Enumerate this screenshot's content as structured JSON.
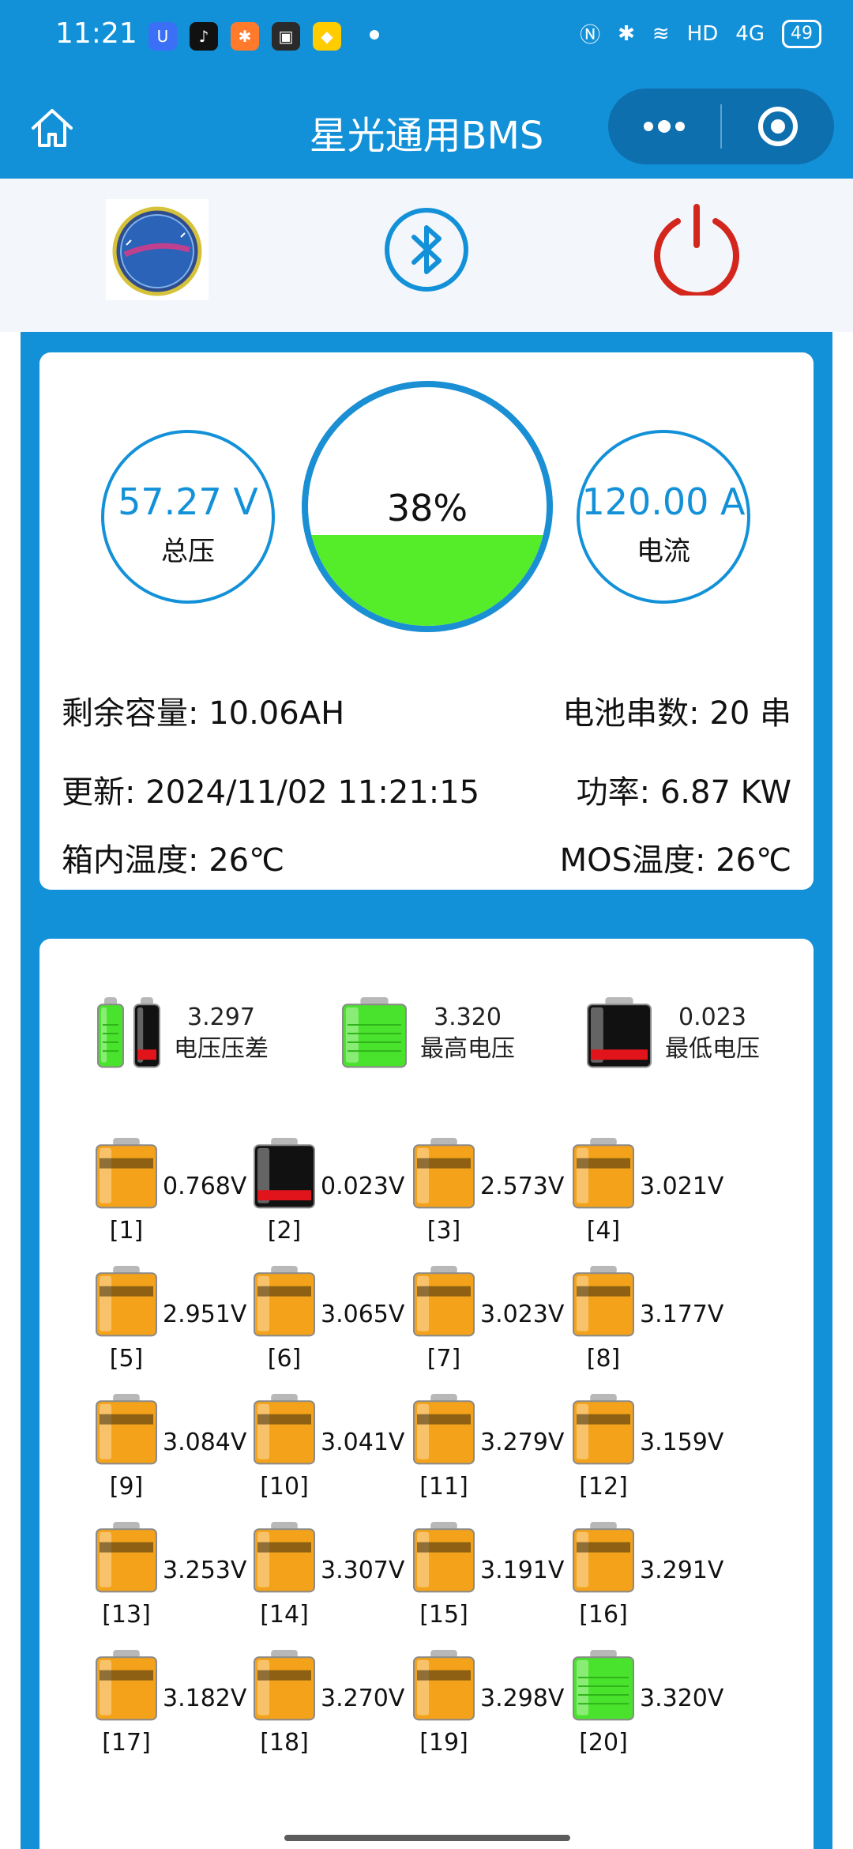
{
  "status_bar": {
    "time": "11:21",
    "apps": [
      {
        "name": "app-u",
        "glyph": "U",
        "color": "#3b6ff5"
      },
      {
        "name": "tiktok",
        "glyph": "♪",
        "color": "#111111"
      },
      {
        "name": "app-person",
        "glyph": "✱",
        "color": "#ff7a2a"
      },
      {
        "name": "app-dark",
        "glyph": "▣",
        "color": "#2a2a2a"
      },
      {
        "name": "app-yellow",
        "glyph": "◆",
        "color": "#ffcc00"
      }
    ],
    "network_label": "HD",
    "signal_label": "4G",
    "battery": "49"
  },
  "nav": {
    "title": "星光通用BMS"
  },
  "summary": {
    "total_voltage": "57.27 V",
    "total_voltage_label": "总压",
    "soc_text": "38%",
    "soc_fraction": 0.38,
    "current": "120.00 A",
    "current_label": "电流",
    "remaining_capacity": "剩余容量: 10.06AH",
    "series_count": "电池串数: 20 串",
    "updated": "更新:  2024/11/02 11:21:15",
    "power": "功率: 6.87 KW",
    "box_temp": "箱内温度:  26℃",
    "mos_temp": "MOS温度: 26℃"
  },
  "stats": [
    {
      "value": "3.297",
      "label": "电压压差",
      "kind": "diff"
    },
    {
      "value": "3.320",
      "label": "最高电压",
      "kind": "high"
    },
    {
      "value": "0.023",
      "label": "最低电压",
      "kind": "low"
    }
  ],
  "cells": [
    {
      "index": "[1]",
      "voltage": "0.768V",
      "kind": "normal"
    },
    {
      "index": "[2]",
      "voltage": "0.023V",
      "kind": "low"
    },
    {
      "index": "[3]",
      "voltage": "2.573V",
      "kind": "normal"
    },
    {
      "index": "[4]",
      "voltage": "3.021V",
      "kind": "normal"
    },
    {
      "index": "[5]",
      "voltage": "2.951V",
      "kind": "normal"
    },
    {
      "index": "[6]",
      "voltage": "3.065V",
      "kind": "normal"
    },
    {
      "index": "[7]",
      "voltage": "3.023V",
      "kind": "normal"
    },
    {
      "index": "[8]",
      "voltage": "3.177V",
      "kind": "normal"
    },
    {
      "index": "[9]",
      "voltage": "3.084V",
      "kind": "normal"
    },
    {
      "index": "[10]",
      "voltage": "3.041V",
      "kind": "normal"
    },
    {
      "index": "[11]",
      "voltage": "3.279V",
      "kind": "normal"
    },
    {
      "index": "[12]",
      "voltage": "3.159V",
      "kind": "normal"
    },
    {
      "index": "[13]",
      "voltage": "3.253V",
      "kind": "normal"
    },
    {
      "index": "[14]",
      "voltage": "3.307V",
      "kind": "normal"
    },
    {
      "index": "[15]",
      "voltage": "3.191V",
      "kind": "normal"
    },
    {
      "index": "[16]",
      "voltage": "3.291V",
      "kind": "normal"
    },
    {
      "index": "[17]",
      "voltage": "3.182V",
      "kind": "normal"
    },
    {
      "index": "[18]",
      "voltage": "3.270V",
      "kind": "normal"
    },
    {
      "index": "[19]",
      "voltage": "3.298V",
      "kind": "normal"
    },
    {
      "index": "[20]",
      "voltage": "3.320V",
      "kind": "high"
    }
  ],
  "colors": {
    "brand_blue": "#1391d8",
    "soc_fill": "#55ed2a",
    "power_red": "#d3261c",
    "cell_orange": "#f3a21a",
    "cell_red": "#e2141b",
    "cell_green": "#49e22c"
  },
  "icons": {
    "home": "home-icon",
    "more": "more-dots-icon",
    "record": "record-target-icon",
    "bluetooth": "bluetooth-icon",
    "power": "power-icon",
    "logo": "bms-logo"
  }
}
